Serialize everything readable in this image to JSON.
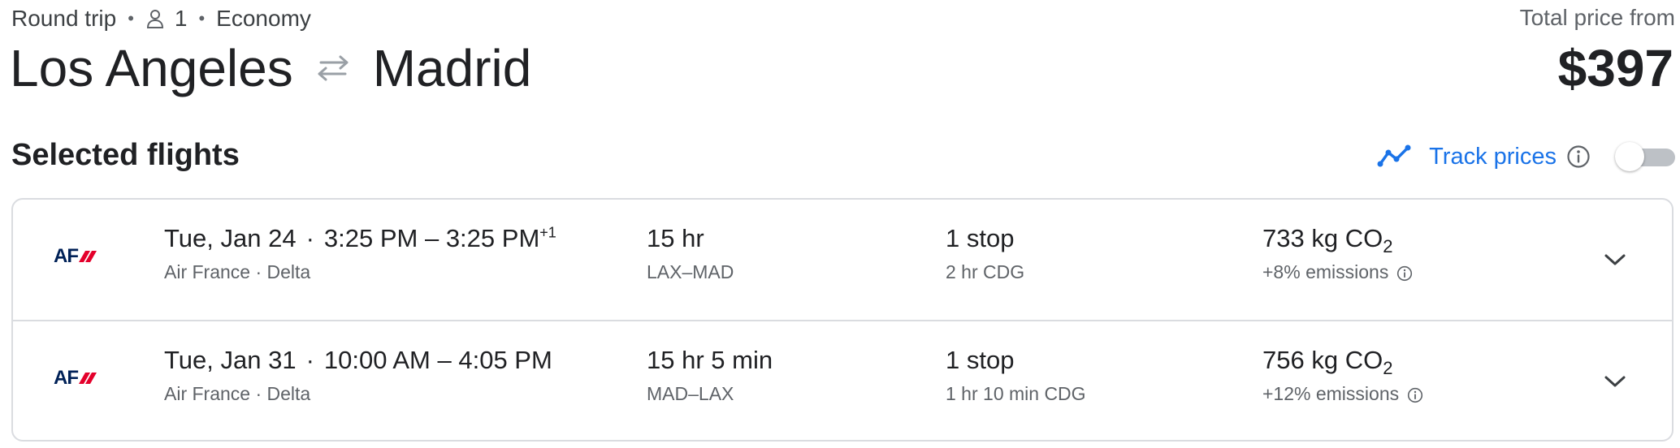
{
  "header": {
    "trip_type": "Round trip",
    "passengers": "1",
    "cabin": "Economy",
    "origin": "Los Angeles",
    "destination": "Madrid",
    "price_label": "Total price from",
    "price": "$397"
  },
  "section": {
    "title": "Selected flights",
    "track_label": "Track prices",
    "track_enabled": false
  },
  "flights": [
    {
      "date": "Tue, Jan 24",
      "times": "3:25 PM – 3:25 PM",
      "day_offset": "+1",
      "airlines": "Air France · Delta",
      "duration": "15 hr",
      "route": "LAX–MAD",
      "stops": "1 stop",
      "layover": "2 hr CDG",
      "emissions_value": "733 kg CO",
      "emissions_subscript": "2",
      "emissions_delta": "+8% emissions",
      "logo_text": "AF"
    },
    {
      "date": "Tue, Jan 31",
      "times": "10:00 AM – 4:05 PM",
      "day_offset": "",
      "airlines": "Air France · Delta",
      "duration": "15 hr 5 min",
      "route": "MAD–LAX",
      "stops": "1 stop",
      "layover": "1 hr 10 min CDG",
      "emissions_value": "756 kg CO",
      "emissions_subscript": "2",
      "emissions_delta": "+12% emissions",
      "logo_text": "AF"
    }
  ],
  "colors": {
    "accent": "#1a73e8",
    "text_primary": "#202124",
    "text_secondary": "#5f6368",
    "divider": "#dadce0",
    "logo_blue": "#002157",
    "logo_red": "#e4002b"
  },
  "icons": {
    "person": "person-icon",
    "swap": "swap-arrows-icon",
    "track": "trend-line-icon",
    "info": "info-icon",
    "expand": "chevron-down-icon"
  }
}
